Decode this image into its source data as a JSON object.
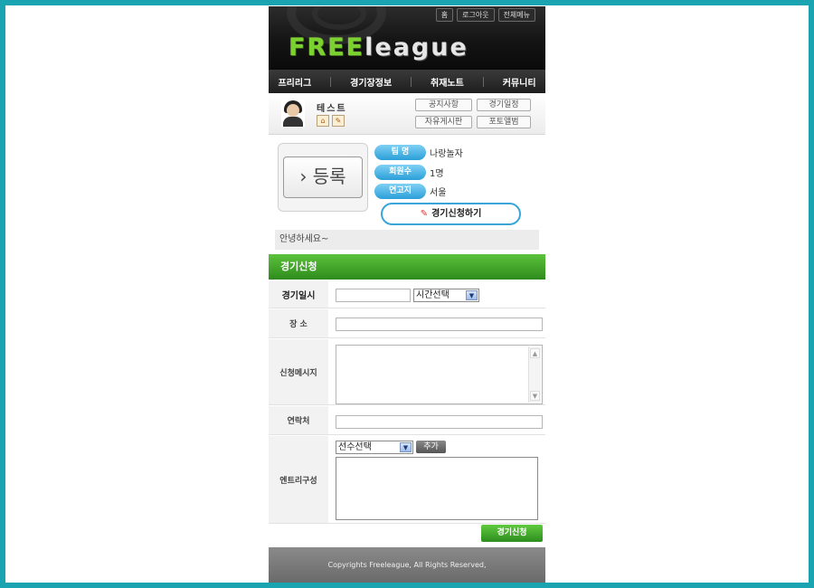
{
  "header": {
    "top_links": [
      "홈",
      "로그아웃",
      "전체메뉴"
    ],
    "logo_left": "FREE",
    "logo_right": "league"
  },
  "nav": [
    "프리리그",
    "경기장정보",
    "취재노트",
    "커뮤니티"
  ],
  "user": {
    "name": "테스트",
    "quick_links": [
      "공지사항",
      "경기일정",
      "자유게시판",
      "포토앨범"
    ]
  },
  "team": {
    "register_label": "› 등록",
    "rows": [
      {
        "label": "팀 명",
        "value": "나랑놀자"
      },
      {
        "label": "회원수",
        "value": "1명"
      },
      {
        "label": "연고지",
        "value": "서울"
      }
    ],
    "apply_button": "경기신청하기"
  },
  "greeting": "안녕하세요~",
  "form": {
    "title": "경기신청",
    "date_label": "경기일시",
    "date_value": "",
    "time_select": "시간선택",
    "place_label": "장 소",
    "place_value": "",
    "message_label": "신청메시지",
    "message_value": "",
    "contact_label": "연락처",
    "contact_value": "",
    "entry_label": "엔트리구성",
    "player_select": "선수선택",
    "add_button": "추가",
    "submit_button": "경기신청"
  },
  "footer": "Copyrights Freeleague, All Rights Reserved,"
}
